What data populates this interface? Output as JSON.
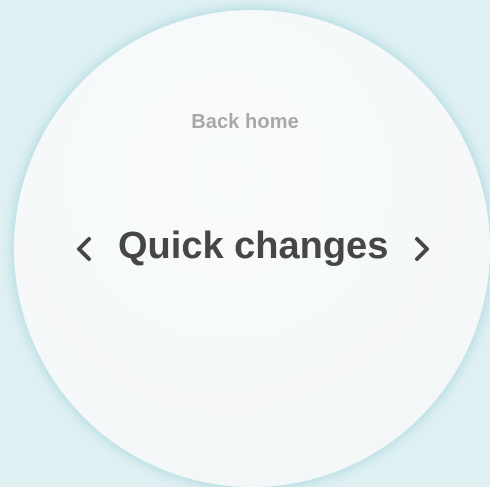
{
  "nav": {
    "back_label": "Back home"
  },
  "card": {
    "title": "Quick changes"
  },
  "icons": {
    "prev": "chevron-left-icon",
    "next": "chevron-right-icon"
  },
  "colors": {
    "background": "#dff0f3",
    "face": "#f6f9f9",
    "title_text": "#464646",
    "link_text": "#a8a8a8"
  }
}
